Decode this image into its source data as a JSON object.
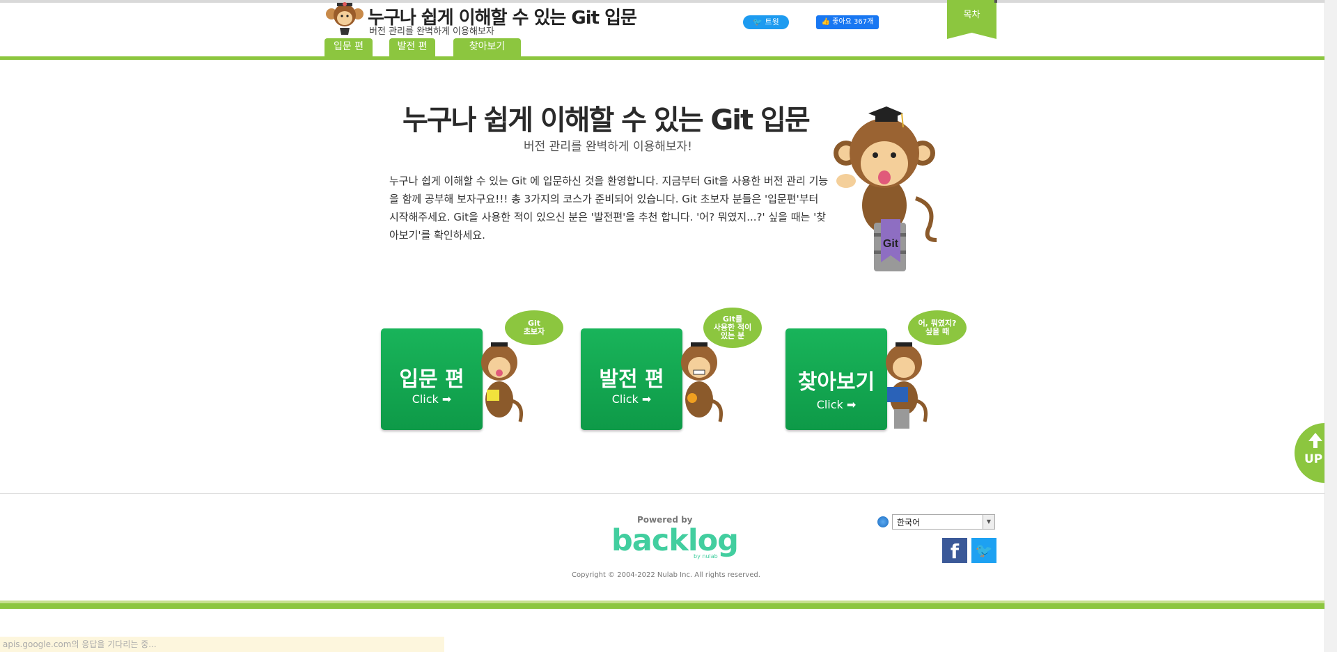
{
  "header": {
    "title": "누구나 쉽게 이해할 수 있는 Git 입문",
    "subtitle": "버전 관리를 완벽하게 이용해보자",
    "tabs": [
      "입문 편",
      "발전 편",
      "찾아보기"
    ],
    "tweet_label": "트윗",
    "like_label": "좋아요 367개",
    "toc_label": "목차"
  },
  "hero": {
    "title": "누구나 쉽게 이해할 수 있는 Git 입문",
    "subtitle": "버전 관리를 완벽하게 이용해보자!",
    "text": "누구나 쉽게 이해할 수 있는 Git 에 입문하신 것을 환영합니다. 지금부터 Git을 사용한 버전 관리 기능을 함께 공부해 보자구요!!! 총 3가지의 코스가 준비되어 있습니다. Git 초보자 분들은 '입문편'부터 시작해주세요. Git을 사용한 적이 있으신 분은 '발전편'을 추천 합니다. '어? 뭐였지...?' 싶을 때는 '찾아보기'를 확인하세요.",
    "badge": "Git"
  },
  "courses": [
    {
      "title": "입문 편",
      "click": "Click ➡",
      "bubble": "Git\n초보자"
    },
    {
      "title": "발전 편",
      "click": "Click ➡",
      "bubble": "Git를\n사용한 적이\n있는 분"
    },
    {
      "title": "찾아보기",
      "click": "Click ➡",
      "bubble": "어, 뭐였지?\n싶을 때"
    }
  ],
  "footer": {
    "powered_by": "Powered by",
    "logo": "backlog",
    "logo_sub": "by nulab",
    "copyright": "Copyright © 2004-2022 Nulab Inc. All rights reserved.",
    "language": "한국어"
  },
  "up_label": "UP",
  "status_text": "apis.google.com의 응답을 기다리는 중...",
  "colors": {
    "accent": "#8cc63f",
    "card": "#12a650",
    "backlog": "#42ce9f"
  }
}
